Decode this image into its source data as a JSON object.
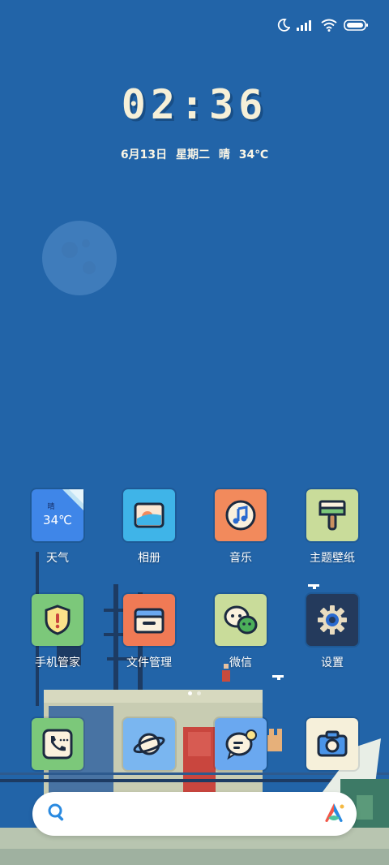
{
  "status_bar": {
    "icons": [
      "moon-dnd-icon",
      "signal-icon",
      "wifi-icon",
      "battery-icon"
    ]
  },
  "lockscreen": {
    "time": "02:36",
    "date": "6月13日 星期二 晴 34℃"
  },
  "apps": [
    {
      "name": "weather",
      "label": "天气",
      "icon": "weather-icon",
      "color": "#3f86e8",
      "condition": "晴",
      "temp": "34℃"
    },
    {
      "name": "gallery",
      "label": "相册",
      "icon": "photo-icon",
      "color": "#3fb4e8"
    },
    {
      "name": "music",
      "label": "音乐",
      "icon": "music-note-icon",
      "color": "#f28a5c"
    },
    {
      "name": "themes",
      "label": "主题壁纸",
      "icon": "paint-brush-icon",
      "color": "#c9dc9a"
    },
    {
      "name": "security",
      "label": "手机管家",
      "icon": "shield-icon",
      "color": "#7cc87a"
    },
    {
      "name": "file-manager",
      "label": "文件管理",
      "icon": "folder-icon",
      "color": "#f07a55"
    },
    {
      "name": "wechat",
      "label": "微信",
      "icon": "chat-bubbles-icon",
      "color": "#c9dc9a"
    },
    {
      "name": "settings",
      "label": "设置",
      "icon": "gear-icon",
      "color": "#243a5c"
    }
  ],
  "dock": [
    {
      "name": "phone",
      "icon": "phone-icon",
      "color": "#7cc87a"
    },
    {
      "name": "browser",
      "icon": "planet-icon",
      "color": "#7ab6f0"
    },
    {
      "name": "messages",
      "icon": "message-icon",
      "color": "#6aa8f0"
    },
    {
      "name": "camera",
      "icon": "camera-icon",
      "color": "#f6f0da"
    }
  ],
  "search": {
    "placeholder": "",
    "icon": "search-icon",
    "assistant_icon": "ai-assistant-icon"
  },
  "page_indicator": {
    "pages": 2,
    "current": 1
  }
}
